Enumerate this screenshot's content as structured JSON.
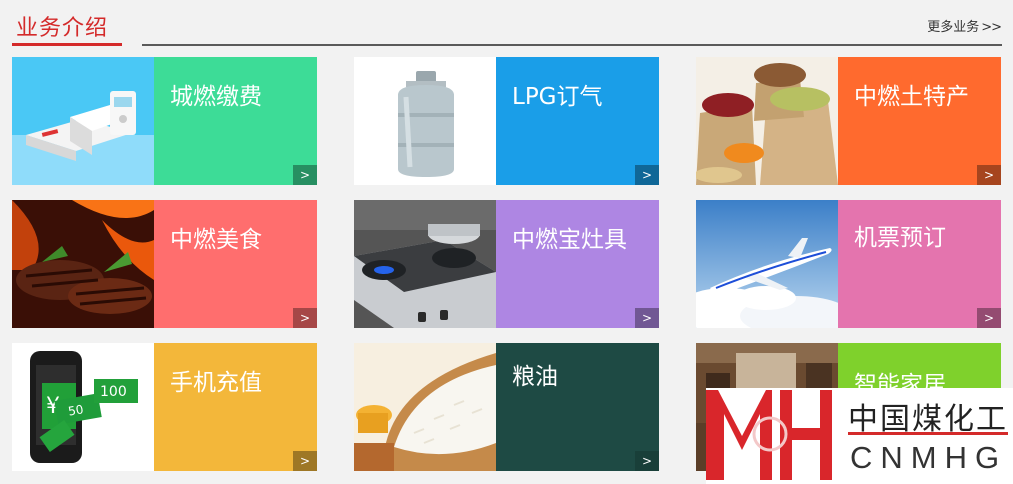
{
  "header": {
    "title": "业务介绍",
    "more_label": "更多业务",
    "more_chevron": ">>"
  },
  "cards": [
    {
      "label": "城燃缴费",
      "color": "#3ddc97",
      "image": "payment-terminal-image",
      "arrow": ">"
    },
    {
      "label": "LPG订气",
      "color": "#1a9ee8",
      "image": "gas-cylinder-image",
      "arrow": ">"
    },
    {
      "label": "中燃土特产",
      "color": "#ff6a2e",
      "image": "dried-fruits-nuts-image",
      "arrow": ">"
    },
    {
      "label": "中燃美食",
      "color": "#ff6e6e",
      "image": "grilled-steak-image",
      "arrow": ">"
    },
    {
      "label": "中燃宝灶具",
      "color": "#ae86e3",
      "image": "gas-stove-image",
      "arrow": ">"
    },
    {
      "label": "机票预订",
      "color": "#e474ae",
      "image": "airplane-image",
      "arrow": ">"
    },
    {
      "label": "手机充值",
      "color": "#f3b73a",
      "image": "phone-recharge-image",
      "arrow": ">"
    },
    {
      "label": "粮油",
      "color": "#1e4a44",
      "image": "rice-bowl-image",
      "arrow": ">"
    },
    {
      "label": "智能家居",
      "color": "#7fd12c",
      "image": "smart-home-room-image",
      "arrow": ">"
    }
  ],
  "watermark": {
    "cn": "中国煤化工",
    "en": "CNMHG"
  }
}
